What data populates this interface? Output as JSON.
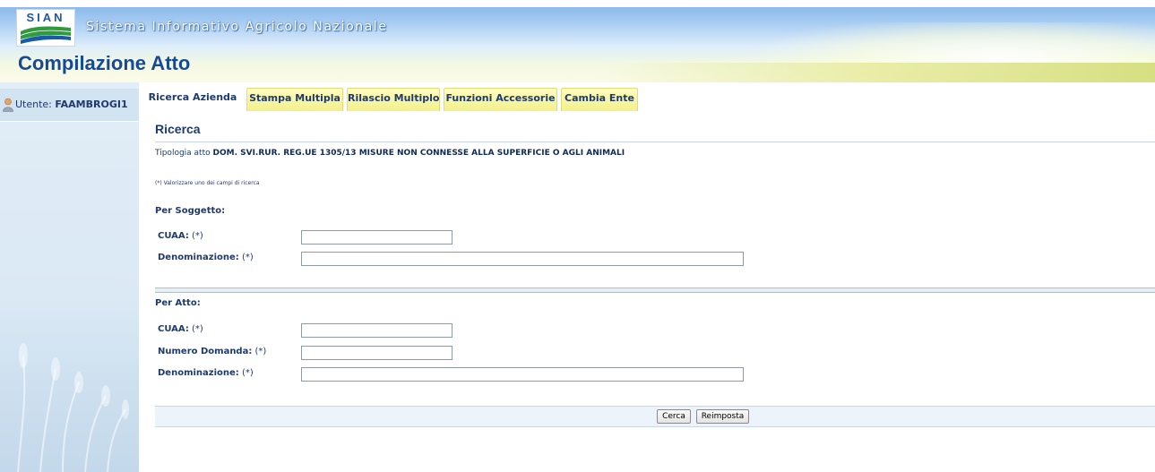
{
  "header": {
    "logo_text": "SIAN",
    "brand_title": "Sistema Informativo Agricolo Nazionale",
    "page_title": "Compilazione Atto"
  },
  "user": {
    "label": "Utente:",
    "name": "FAAMBROGI1"
  },
  "tabs": [
    {
      "label": "Ricerca Azienda",
      "active": true
    },
    {
      "label": "Stampa Multipla",
      "active": false
    },
    {
      "label": "Rilascio Multiplo",
      "active": false
    },
    {
      "label": "Funzioni Accessorie",
      "active": false
    },
    {
      "label": "Cambia Ente",
      "active": false
    }
  ],
  "search": {
    "title": "Ricerca",
    "tipologia_label": "Tipologia atto",
    "tipologia_value": "DOM. SVI.RUR. REG.UE 1305/13 MISURE NON CONNESSE ALLA SUPERFICIE O AGLI ANIMALI",
    "note": "(*) Valorizzare uno dei campi di ricerca",
    "per_soggetto": {
      "title": "Per Soggetto:",
      "cuaa_label": "CUAA:",
      "cuaa_value": "",
      "denominazione_label": "Denominazione:",
      "denominazione_value": ""
    },
    "per_atto": {
      "title": "Per Atto:",
      "cuaa_label": "CUAA:",
      "cuaa_value": "",
      "numero_label": "Numero Domanda:",
      "numero_value": "",
      "denominazione_label": "Denominazione:",
      "denominazione_value": ""
    },
    "required_marker": "(*)",
    "buttons": {
      "cerca": "Cerca",
      "reimposta": "Reimposta"
    }
  },
  "colors": {
    "title_blue": "#164a94",
    "text_blue": "#1e3a6e",
    "tab_yellow": "#f3f08a",
    "sidebar_blue": "#dbe9f5"
  }
}
